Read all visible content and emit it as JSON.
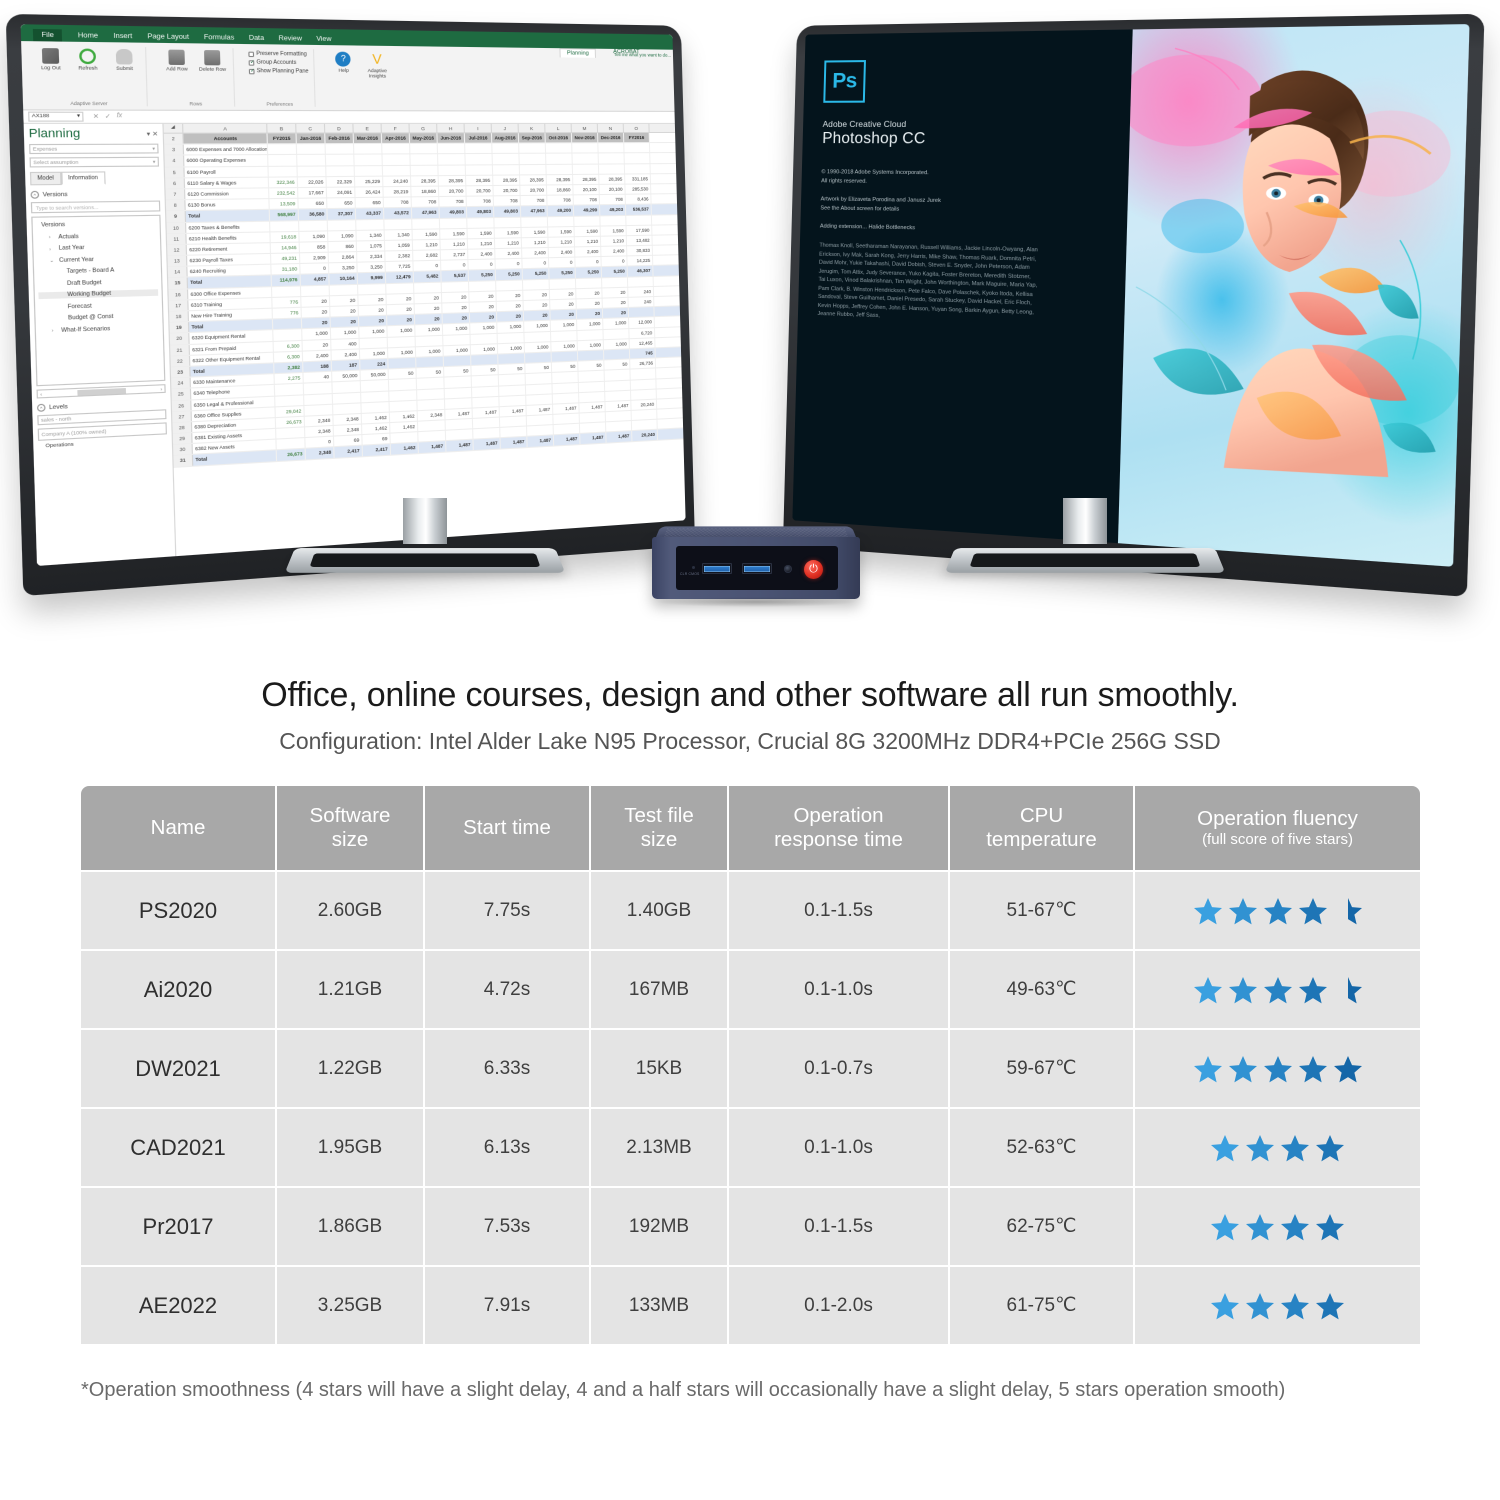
{
  "headline": "Office, online courses, design and other software all run smoothly.",
  "subline": "Configuration: Intel Alder Lake N95 Processor,  Crucial 8G 3200MHz DDR4+PCIe 256G SSD",
  "footnote": "*Operation smoothness (4 stars will have a slight delay, 4 and a half stars will occasionally have a slight delay, 5 stars operation smooth)",
  "colors": {
    "header_bg": "#a8a8a8",
    "row_bg": "#e4e4e4",
    "star_light": "#3aa0e0",
    "star_dark": "#1466a8",
    "headline_text": "#1b1b1b",
    "sub_text": "#555555",
    "power_button": "#e03023",
    "excel_green": "#1e6b41",
    "ps_accent": "#2bb9e8"
  },
  "table": {
    "columns": [
      {
        "label": "Name",
        "sub": ""
      },
      {
        "label": "Software",
        "sub": "size"
      },
      {
        "label": "Start time",
        "sub": ""
      },
      {
        "label": "Test file",
        "sub": "size"
      },
      {
        "label": "Operation",
        "sub": "response time"
      },
      {
        "label": "CPU",
        "sub": "temperature"
      },
      {
        "label": "Operation fluency",
        "sub": "(full score of five stars)"
      }
    ],
    "rows": [
      {
        "name": "PS2020",
        "software_size": "2.60GB",
        "start_time": "7.75s",
        "test_file_size": "1.40GB",
        "response_time": "0.1-1.5s",
        "cpu_temperature": "51-67℃",
        "stars": 4.5
      },
      {
        "name": "Ai2020",
        "software_size": "1.21GB",
        "start_time": "4.72s",
        "test_file_size": "167MB",
        "response_time": "0.1-1.0s",
        "cpu_temperature": "49-63℃",
        "stars": 4.5
      },
      {
        "name": "DW2021",
        "software_size": "1.22GB",
        "start_time": "6.33s",
        "test_file_size": "15KB",
        "response_time": "0.1-0.7s",
        "cpu_temperature": "59-67℃",
        "stars": 5
      },
      {
        "name": "CAD2021",
        "software_size": "1.95GB",
        "start_time": "6.13s",
        "test_file_size": "2.13MB",
        "response_time": "0.1-1.0s",
        "cpu_temperature": "52-63℃",
        "stars": 4
      },
      {
        "name": "Pr2017",
        "software_size": "1.86GB",
        "start_time": "7.53s",
        "test_file_size": "192MB",
        "response_time": "0.1-1.5s",
        "cpu_temperature": "62-75℃",
        "stars": 4
      },
      {
        "name": "AE2022",
        "software_size": "3.25GB",
        "start_time": "7.91s",
        "test_file_size": "133MB",
        "response_time": "0.1-2.0s",
        "cpu_temperature": "61-75℃",
        "stars": 4
      }
    ]
  },
  "left_monitor": {
    "app": "Microsoft Excel",
    "ribbon_tabs": [
      "File",
      "Home",
      "Insert",
      "Page Layout",
      "Formulas",
      "Data",
      "Review",
      "View"
    ],
    "context_tabs": [
      "Planning",
      "ACROBAT"
    ],
    "tell_me": "Tell me what you want to do...",
    "ribbon_groups": [
      {
        "name": "Adaptive Server",
        "items": [
          "Log Out",
          "Refresh",
          "Submit"
        ]
      },
      {
        "name": "Rows",
        "items": [
          "Add Row",
          "Delete Row"
        ]
      },
      {
        "name": "Preferences",
        "items": [
          "Preserve Formatting",
          "Group Accounts",
          "Show Planning Pane"
        ]
      },
      {
        "name": "",
        "items": [
          "Help",
          "Adaptive Insights"
        ]
      }
    ],
    "checkboxes": [
      {
        "label": "Preserve Formatting",
        "checked": false
      },
      {
        "label": "Group Accounts",
        "checked": true
      },
      {
        "label": "Show Planning Pane",
        "checked": true
      }
    ],
    "name_box": "AX188",
    "pane": {
      "title": "Planning",
      "close": "✕",
      "select1": "Expenses",
      "select2": "Select assumption",
      "tabs": [
        {
          "label": "Model",
          "active": false
        },
        {
          "label": "Information",
          "active": true
        }
      ],
      "section_versions": "Versions",
      "search_placeholder": "Type to search versions...",
      "tree_root": "Versions",
      "tree": [
        {
          "label": "Actuals",
          "depth": 1,
          "arrow": "›",
          "selected": false
        },
        {
          "label": "Last Year",
          "depth": 1,
          "arrow": "›",
          "selected": false
        },
        {
          "label": "Current Year",
          "depth": 1,
          "arrow": "⌄",
          "selected": false
        },
        {
          "label": "Targets - Board A",
          "depth": 2,
          "arrow": "",
          "selected": false
        },
        {
          "label": "Draft Budget",
          "depth": 2,
          "arrow": "",
          "selected": false
        },
        {
          "label": "Working Budget",
          "depth": 2,
          "arrow": "",
          "selected": true
        },
        {
          "label": "Forecast",
          "depth": 2,
          "arrow": "",
          "selected": false
        },
        {
          "label": "Budget @ Const",
          "depth": 2,
          "arrow": "",
          "selected": false
        },
        {
          "label": "What-If Scenarios",
          "depth": 1,
          "arrow": "›",
          "selected": false
        }
      ],
      "section_levels": "Levels",
      "level1": "sales - north",
      "level2": "Company A (100% owned)",
      "level3": "Operations"
    },
    "grid": {
      "col_letters": [
        "A",
        "B",
        "C",
        "D",
        "E",
        "F",
        "G",
        "H",
        "I",
        "J",
        "K",
        "L",
        "M",
        "N",
        "O"
      ],
      "header_row": [
        "Accounts",
        "FY2015",
        "Jan-2016",
        "Feb-2016",
        "Mar-2016",
        "Apr-2016",
        "May-2016",
        "Jun-2016",
        "Jul-2016",
        "Aug-2016",
        "Sep-2016",
        "Oct-2016",
        "Nov-2016",
        "Dec-2016",
        "FY2016"
      ],
      "rows": [
        {
          "n": "3",
          "account": "6000 Expenses and 7000 Allocations",
          "vals": []
        },
        {
          "n": "4",
          "account": "  6000 Operating Expenses",
          "vals": []
        },
        {
          "n": "5",
          "account": "    6100 Payroll",
          "vals": []
        },
        {
          "n": "6",
          "account": "      6110 Salary & Wages",
          "vals": [
            "322,346",
            "22,026",
            "22,329",
            "25,229",
            "24,240",
            "28,395",
            "28,395",
            "28,395",
            "28,395",
            "28,395",
            "28,395",
            "28,395",
            "28,395",
            "331,185"
          ]
        },
        {
          "n": "7",
          "account": "      6120 Commission",
          "vals": [
            "232,542",
            "17,667",
            "24,091",
            "26,424",
            "28,219",
            "18,860",
            "20,700",
            "20,700",
            "20,700",
            "20,700",
            "18,860",
            "20,100",
            "20,100",
            "285,530"
          ]
        },
        {
          "n": "8",
          "account": "      6130 Bonus",
          "vals": [
            "13,509",
            "650",
            "650",
            "650",
            "708",
            "708",
            "708",
            "708",
            "708",
            "708",
            "708",
            "708",
            "708",
            "8,436"
          ],
          "blue": false
        },
        {
          "n": "9",
          "account": "    Total",
          "vals": [
            "568,997",
            "36,580",
            "37,307",
            "43,337",
            "43,572",
            "47,963",
            "49,803",
            "49,803",
            "49,803",
            "47,963",
            "49,200",
            "49,299",
            "49,203",
            "536,537"
          ],
          "blue": true
        },
        {
          "n": "10",
          "account": "    6200 Taxes & Benefits",
          "vals": []
        },
        {
          "n": "11",
          "account": "      6210 Health Benefits",
          "vals": [
            "19,618",
            "1,090",
            "1,090",
            "1,340",
            "1,340",
            "1,590",
            "1,590",
            "1,590",
            "1,590",
            "1,590",
            "1,590",
            "1,590",
            "1,590",
            "17,590"
          ]
        },
        {
          "n": "12",
          "account": "      6220 Retirement",
          "vals": [
            "14,946",
            "858",
            "860",
            "1,075",
            "1,059",
            "1,210",
            "1,210",
            "1,210",
            "1,210",
            "1,210",
            "1,210",
            "1,210",
            "1,210",
            "13,482"
          ]
        },
        {
          "n": "13",
          "account": "      6230 Payroll Taxes",
          "vals": [
            "49,231",
            "2,909",
            "2,864",
            "2,334",
            "2,382",
            "2,682",
            "2,737",
            "2,400",
            "2,400",
            "2,400",
            "2,400",
            "2,400",
            "2,400",
            "30,833"
          ]
        },
        {
          "n": "14",
          "account": "      6240 Recruiting",
          "vals": [
            "31,180",
            "0",
            "3,250",
            "3,250",
            "7,725",
            "0",
            "0",
            "0",
            "0",
            "0",
            "0",
            "0",
            "0",
            "14,225"
          ]
        },
        {
          "n": "15",
          "account": "    Total",
          "vals": [
            "114,976",
            "4,857",
            "10,164",
            "9,999",
            "12,479",
            "5,482",
            "5,537",
            "5,250",
            "5,250",
            "5,250",
            "5,250",
            "5,250",
            "5,250",
            "46,307"
          ],
          "blue": true
        },
        {
          "n": "16",
          "account": "  6300 Office Expenses",
          "vals": []
        },
        {
          "n": "17",
          "account": "    6310 Training",
          "vals": [
            "776",
            "20",
            "20",
            "20",
            "20",
            "20",
            "20",
            "20",
            "20",
            "20",
            "20",
            "20",
            "20",
            "240"
          ]
        },
        {
          "n": "18",
          "account": "      New Hire Training",
          "vals": [
            "776",
            "20",
            "20",
            "20",
            "20",
            "20",
            "20",
            "20",
            "20",
            "20",
            "20",
            "20",
            "20",
            "240"
          ]
        },
        {
          "n": "19",
          "account": "    Total",
          "vals": [
            "",
            "20",
            "20",
            "20",
            "20",
            "20",
            "20",
            "20",
            "20",
            "20",
            "20",
            "20",
            "20",
            ""
          ],
          "blue": true
        },
        {
          "n": "20",
          "account": "    6320 Equipment Rental",
          "vals": [
            "",
            "1,000",
            "1,000",
            "1,000",
            "1,000",
            "1,000",
            "1,000",
            "1,000",
            "1,000",
            "1,000",
            "1,000",
            "1,000",
            "1,000",
            "12,000"
          ]
        },
        {
          "n": "21",
          "account": "      6321 From Prepaid",
          "vals": [
            "6,300",
            "20",
            "400",
            "",
            "",
            "",
            "",
            "",
            "",
            "",
            "",
            "",
            "",
            "6,720"
          ]
        },
        {
          "n": "22",
          "account": "      6322 Other Equipment Rental",
          "vals": [
            "6,300",
            "2,400",
            "2,400",
            "1,000",
            "1,000",
            "1,000",
            "1,000",
            "1,000",
            "1,000",
            "1,000",
            "1,000",
            "1,000",
            "1,000",
            "12,465"
          ]
        },
        {
          "n": "23",
          "account": "    Total",
          "vals": [
            "2,382",
            "188",
            "187",
            "224",
            "",
            "",
            "",
            "",
            "",
            "",
            "",
            "",
            "",
            "745"
          ],
          "blue": true
        },
        {
          "n": "24",
          "account": "    6330 Maintenance",
          "vals": [
            "2,275",
            "40",
            "50,000",
            "50,000",
            "50",
            "50",
            "50",
            "50",
            "50",
            "50",
            "50",
            "50",
            "50",
            "26,736"
          ]
        },
        {
          "n": "25",
          "account": "    6340 Telephone",
          "vals": []
        },
        {
          "n": "26",
          "account": "    6350 Legal & Professional",
          "vals": []
        },
        {
          "n": "27",
          "account": "    6360 Office Supplies",
          "vals": [
            "29,042",
            "",
            "",
            "",
            "",
            "",
            "",
            "",
            "",
            "",
            "",
            "",
            "",
            ""
          ]
        },
        {
          "n": "28",
          "account": "    6380 Depreciation",
          "vals": [
            "26,673",
            "2,348",
            "2,348",
            "1,462",
            "1,462",
            "2,348",
            "1,487",
            "1,487",
            "1,487",
            "1,487",
            "1,487",
            "1,487",
            "1,487",
            "20,240"
          ]
        },
        {
          "n": "29",
          "account": "      6381 Existing Assets",
          "vals": [
            "",
            "2,348",
            "2,348",
            "1,462",
            "1,462",
            "",
            "",
            "",
            "",
            "",
            "",
            "",
            "",
            ""
          ]
        },
        {
          "n": "30",
          "account": "      6382 New Assets",
          "vals": [
            "",
            "0",
            "69",
            "69",
            "",
            "",
            "",
            "",
            "",
            "",
            "",
            "",
            "",
            ""
          ]
        },
        {
          "n": "31",
          "account": "    Total",
          "vals": [
            "26,673",
            "2,348",
            "2,417",
            "2,417",
            "1,462",
            "1,487",
            "1,487",
            "1,487",
            "1,487",
            "1,487",
            "1,487",
            "1,487",
            "1,487",
            "20,240"
          ],
          "blue": true
        }
      ]
    }
  },
  "right_monitor": {
    "app": "Adobe Photoshop CC",
    "logo_text": "Ps",
    "suite": "Adobe Creative Cloud",
    "product": "Photoshop CC",
    "copyright_line1": "© 1990-2018 Adobe Systems Incorporated.",
    "copyright_line2": "All rights reserved.",
    "artwork_line1": "Artwork by Elizaveta Porodina and Janusz Jurek",
    "artwork_line2": "See the About screen for details",
    "status": "Adding extension... Halide Bottlenecks",
    "credits": "Thomas Knoll, Seetharaman Narayanan, Russell Williams, Jackie Lincoln-Owyang, Alan Erickson, Ivy Mak, Sarah Kong, Jerry Harris, Mike Shaw, Thomas Ruark, Domnita Petri, David Mohr, Yukie Takahashi, David Dobish, Steven E. Snyder, John Peterson, Adam Jerugim, Tom Attix, Judy Severance, Yuko Kagita, Foster Brereton, Meredith Stotzner, Tai Luxon, Vinod Balakrishnan, Tim Wright, John Worthington, Mark Maguire, Maria Yap, Pam Clark, B. Winston Hendrickson, Pete Falco, Dave Polaschek, Kyoko Itoda, Kellisa Sandoval, Steve Guilhamet, Daniel Presedo, Sarah Stuckey, David Hackel, Eric Floch, Kevin Hopps, Jeffrey Cohen, John E. Hanson, Yuyan Song, Barkin Aygun, Betty Leong, Jeanne Rubbo, Jeff Sass,"
  },
  "mini_pc": {
    "label": "CLR CMOS",
    "ports": [
      "usb-3.0-port",
      "usb-3.0-port",
      "headphone-jack",
      "power-button"
    ],
    "power_glyph": "⏻"
  }
}
